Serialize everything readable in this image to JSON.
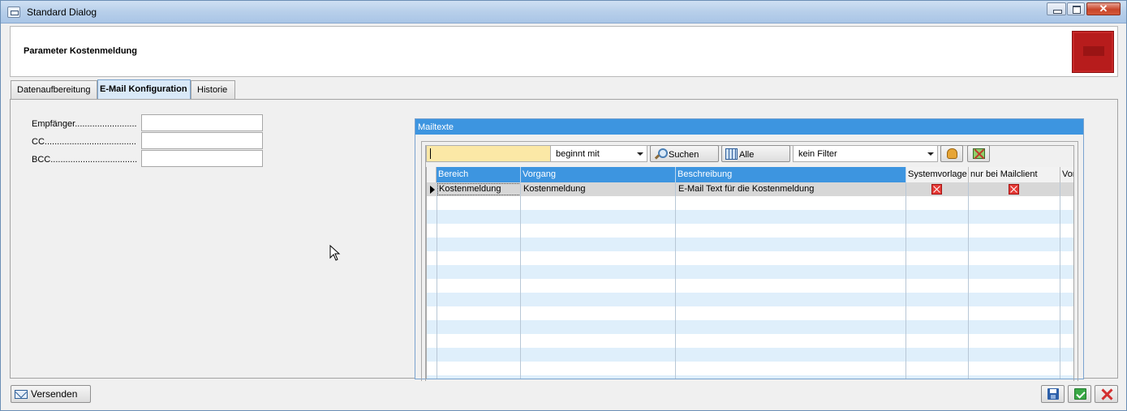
{
  "window": {
    "title": "Standard Dialog",
    "close_glyph": "✕"
  },
  "header": {
    "title": "Parameter Kostenmeldung"
  },
  "tabs": [
    {
      "label": "Datenaufbereitung",
      "active": false
    },
    {
      "label": "E-Mail Konfiguration",
      "active": true
    },
    {
      "label": "Historie",
      "active": false
    }
  ],
  "fields": [
    {
      "label": "Empfänger.........................",
      "value": ""
    },
    {
      "label": "CC.....................................................",
      "value": ""
    },
    {
      "label": "BCC.......................................",
      "value": ""
    }
  ],
  "mailtexte": {
    "title": "Mailtexte",
    "search_value": "",
    "match_mode": "beginnt mit",
    "search_button": "Suchen",
    "all_button": "Alle",
    "filter": "kein Filter",
    "columns": [
      "Bereich",
      "Vorgang",
      "Beschreibung",
      "Systemvorlage",
      "nur bei Mailclient",
      "Vor"
    ],
    "rows": [
      {
        "bereich": "Kostenmeldung",
        "vorgang": "Kostenmeldung",
        "beschreibung": "E-Mail Text für die Kostenmeldung",
        "systemvorlage": true,
        "nur_bei_mailclient": true
      }
    ]
  },
  "footer": {
    "send_button": "Versenden"
  },
  "colors": {
    "accent": "#3d95e0",
    "row_alt": "#dfeffb",
    "search_highlight": "#fbe8a6",
    "logo": "#b71c1c"
  },
  "icons": [
    "window-menu-icon",
    "minimize-icon",
    "maximize-icon",
    "close-icon",
    "magnifier-icon",
    "grid-icon",
    "hand-icon",
    "filter-remove-icon",
    "envelope-icon",
    "save-icon",
    "ok-icon",
    "cancel-icon"
  ]
}
